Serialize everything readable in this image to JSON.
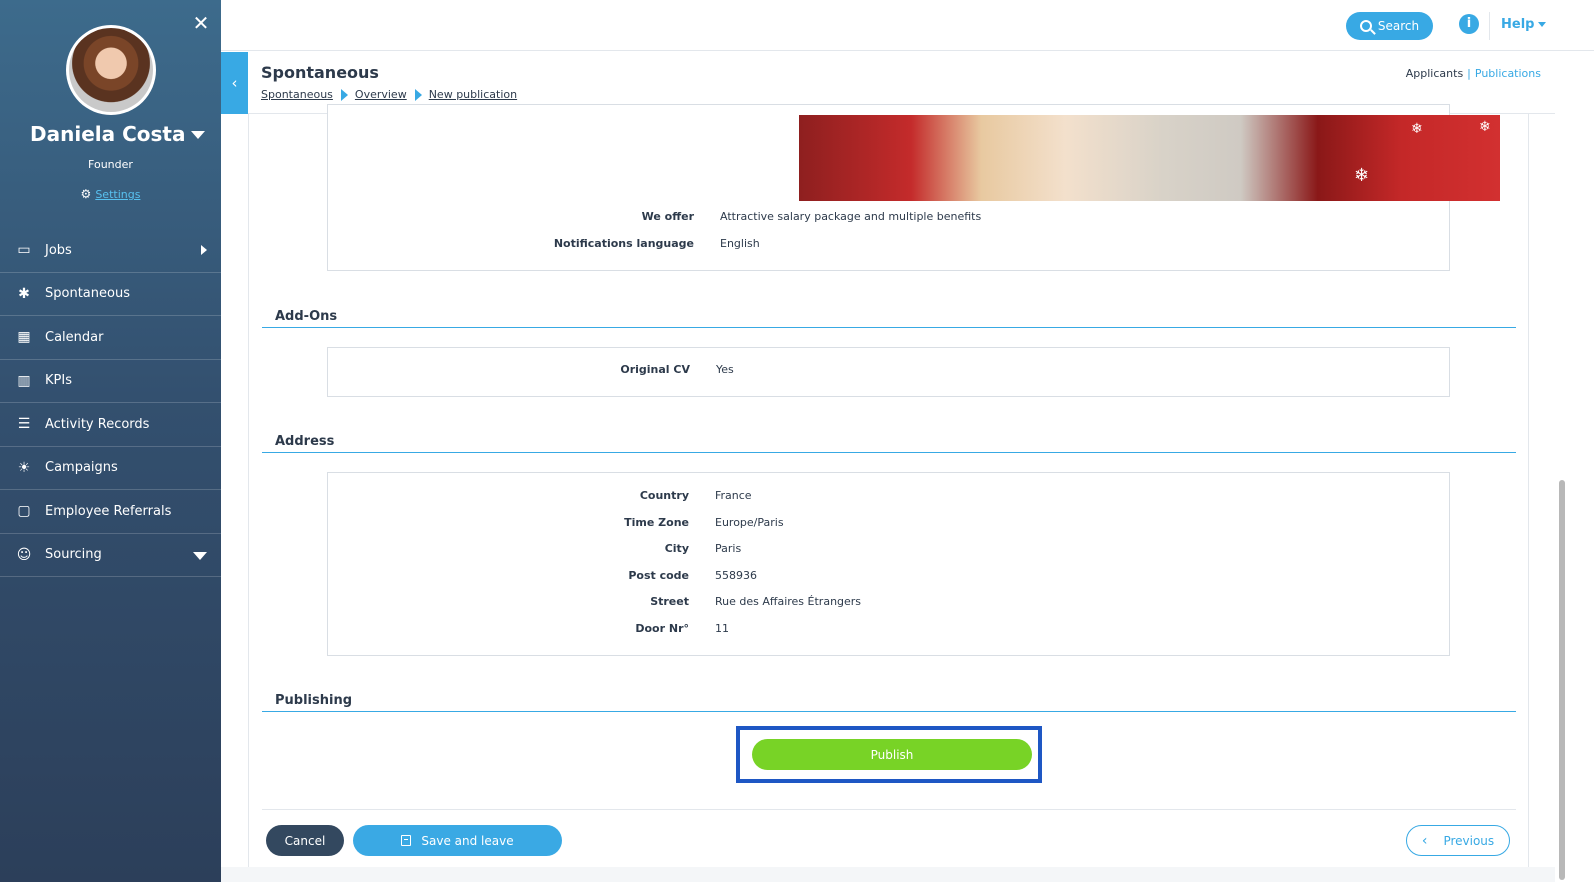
{
  "sidebar": {
    "user_name": "Daniela Costa",
    "role": "Founder",
    "settings_label": "Settings",
    "items": [
      {
        "label": "Jobs",
        "icon": "folder-icon"
      },
      {
        "label": "Spontaneous",
        "icon": "asterisk-icon"
      },
      {
        "label": "Calendar",
        "icon": "calendar-icon"
      },
      {
        "label": "KPIs",
        "icon": "bar-chart-icon"
      },
      {
        "label": "Activity Records",
        "icon": "list-icon"
      },
      {
        "label": "Campaigns",
        "icon": "sun-icon"
      },
      {
        "label": "Employee Referrals",
        "icon": "comment-icon"
      },
      {
        "label": "Sourcing",
        "icon": "users-icon"
      }
    ]
  },
  "topbar": {
    "search_label": "Search",
    "help_label": "Help"
  },
  "header": {
    "title": "Spontaneous",
    "breadcrumb": [
      "Spontaneous",
      "Overview",
      "New publication"
    ],
    "link_applicants": "Applicants",
    "link_separator": "|",
    "link_publications": "Publications"
  },
  "details": {
    "we_offer_label": "We offer",
    "we_offer_value": "Attractive salary package and multiple benefits",
    "notif_lang_label": "Notifications language",
    "notif_lang_value": "English"
  },
  "addons": {
    "title": "Add-Ons",
    "original_cv_label": "Original CV",
    "original_cv_value": "Yes"
  },
  "address": {
    "title": "Address",
    "rows": [
      {
        "label": "Country",
        "value": "France"
      },
      {
        "label": "Time Zone",
        "value": "Europe/Paris"
      },
      {
        "label": "City",
        "value": "Paris"
      },
      {
        "label": "Post code",
        "value": "558936"
      },
      {
        "label": "Street",
        "value": "Rue des Affaires Étrangers"
      },
      {
        "label": "Door Nr°",
        "value": "11"
      }
    ]
  },
  "publishing": {
    "title": "Publishing",
    "publish_label": "Publish"
  },
  "footer": {
    "cancel_label": "Cancel",
    "save_label": "Save and leave",
    "previous_label": "Previous"
  },
  "colors": {
    "accent": "#38a9e4",
    "publish_green": "#78d326",
    "highlight_border": "#1e57c4",
    "sidebar_dark": "#2c3f5a"
  }
}
